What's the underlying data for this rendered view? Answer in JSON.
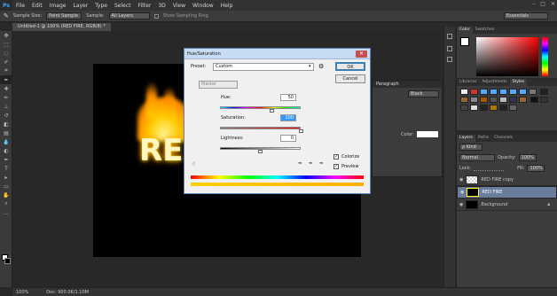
{
  "app": {
    "logo": "Ps",
    "menus": [
      "File",
      "Edit",
      "Image",
      "Layer",
      "Type",
      "Select",
      "Filter",
      "3D",
      "View",
      "Window",
      "Help"
    ],
    "window_controls": [
      "–",
      "□",
      "✕"
    ]
  },
  "options": {
    "sample_size_label": "Sample Size:",
    "sample_size_value": "Point Sample",
    "sample_label": "Sample:",
    "sample_value": "All Layers",
    "show_ring": "Show Sampling Ring",
    "workspace": "Essentials"
  },
  "document": {
    "tab_title": "Untitled-1 @ 100% (RED FIRE, RGB/8) *",
    "text": "RE"
  },
  "status": {
    "zoom": "100%",
    "doc": "Doc: 900.0K/1.10M"
  },
  "dialog": {
    "title": "Hue/Saturation",
    "preset_label": "Preset:",
    "preset_value": "Custom",
    "channel": "Master",
    "hue_label": "Hue:",
    "hue_value": "50",
    "hue_pos": 0.64,
    "saturation_label": "Saturation:",
    "saturation_value": "100",
    "saturation_pos": 1.0,
    "lightness_label": "Lightness:",
    "lightness_value": "0",
    "lightness_pos": 0.5,
    "ok": "OK",
    "cancel": "Cancel",
    "colorize": "Colorize",
    "preview": "Preview"
  },
  "color_panel": {
    "tabs": [
      "Color",
      "Swatches"
    ]
  },
  "styles_panel": {
    "tabs": [
      "Libraries",
      "Adjustments",
      "Styles"
    ]
  },
  "layers_panel": {
    "tabs": [
      "Layers",
      "Paths",
      "Channels"
    ],
    "kind": "ρ Kind",
    "mode": "Normal",
    "opacity_label": "Opacity:",
    "opacity": "100%",
    "lock_label": "Lock:",
    "fill_label": "Fill:",
    "fill": "100%",
    "layers": [
      {
        "name": "RED FIRE copy"
      },
      {
        "name": "RED FIRE"
      },
      {
        "name": "Background"
      }
    ]
  },
  "char_panel": {
    "tab": "Paragraph",
    "font_style": "Black",
    "color_label": "Color:"
  }
}
